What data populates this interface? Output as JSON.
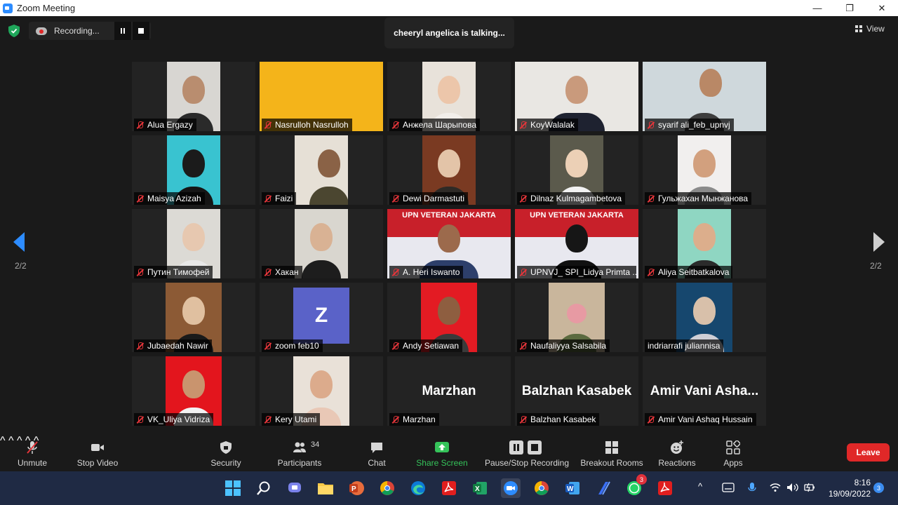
{
  "window": {
    "title": "Zoom Meeting",
    "controls": [
      "—",
      "❐",
      "✕"
    ]
  },
  "meeting": {
    "recording_label": "Recording...",
    "active_speaker": "cheeryl angelica is talking...",
    "view_label": "View",
    "page_left": "2/2",
    "page_right": "2/2"
  },
  "participants": [
    {
      "name": "Alua Ergazy"
    },
    {
      "name": "Nasrulloh Nasrulloh"
    },
    {
      "name": "Анжела Шарыпова"
    },
    {
      "name": "KoyWalalak"
    },
    {
      "name": "syarif ali_feb_upnvj"
    },
    {
      "name": "Maisya Azizah"
    },
    {
      "name": "Faizi"
    },
    {
      "name": "Dewi Darmastuti"
    },
    {
      "name": "Dilnaz Kulmagambetova"
    },
    {
      "name": "Гульжахан Мынжанова"
    },
    {
      "name": "Путин Тимофей"
    },
    {
      "name": "Хакан"
    },
    {
      "name": "A. Heri Iswanto",
      "banner": "UPN VETERAN JAKARTA"
    },
    {
      "name": "UPNVJ_ SPI_Lidya Primta ...",
      "banner": "UPN VETERAN JAKARTA"
    },
    {
      "name": "Aliya Seitbatkalova"
    },
    {
      "name": "Jubaedah Nawir"
    },
    {
      "name": "zoom feb10",
      "avatar_letter": "Z"
    },
    {
      "name": "Andy Setiawan"
    },
    {
      "name": "Naufaliyya Salsabila"
    },
    {
      "name": "indriarrafi juliannisa"
    },
    {
      "name": "VK_Uliya Vidriza"
    },
    {
      "name": "Kery Utami"
    },
    {
      "name": "Marzhan",
      "display": "Marzhan"
    },
    {
      "name": "Balzhan Kasabek",
      "display": "Balzhan Kasabek"
    },
    {
      "name": "Amir Vani Ashaq Hussain",
      "display": "Amir  Vani  Asha..."
    }
  ],
  "toolbar": {
    "unmute": "Unmute",
    "stop_video": "Stop Video",
    "security": "Security",
    "participants": "Participants",
    "participants_count": "34",
    "chat": "Chat",
    "share_screen": "Share Screen",
    "pause_stop_recording": "Pause/Stop Recording",
    "breakout_rooms": "Breakout Rooms",
    "reactions": "Reactions",
    "apps": "Apps",
    "leave": "Leave"
  },
  "taskbar": {
    "apps": [
      "windows-start",
      "search",
      "teams-chat",
      "file-explorer",
      "powerpoint",
      "chrome-profile",
      "edge",
      "acrobat",
      "excel",
      "zoom",
      "chrome",
      "word",
      "pen-app",
      "whatsapp",
      "acrobat-2"
    ],
    "whatsapp_badge": "3",
    "time": "8:16",
    "date": "19/09/2022",
    "notification_count": "3"
  },
  "colors": {
    "accent_blue": "#2d8cff",
    "share_green": "#35c35a",
    "leave_red": "#e02828",
    "muted_red": "#e5353a"
  }
}
